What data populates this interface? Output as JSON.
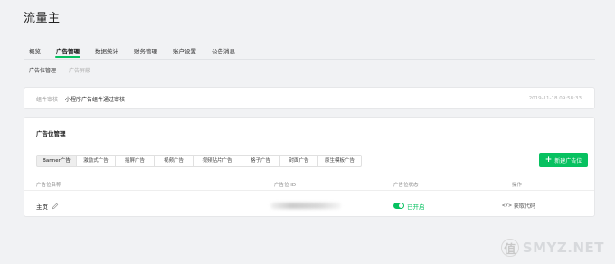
{
  "header": {
    "title": "流量主"
  },
  "main_tabs": [
    {
      "label": "概览"
    },
    {
      "label": "广告管理",
      "active": true
    },
    {
      "label": "数据统计"
    },
    {
      "label": "财务管理"
    },
    {
      "label": "账户设置"
    },
    {
      "label": "公告消息"
    }
  ],
  "sub_tabs": [
    {
      "label": "广告位管理",
      "active": true
    },
    {
      "label": "广告屏蔽",
      "disabled": true
    }
  ],
  "notice": {
    "label": "组件审核",
    "text": "小程序广告组件通过审核",
    "time": "2019-11-18 09:58:33"
  },
  "ad_slots": {
    "title": "广告位管理",
    "type_tabs": [
      "Banner广告",
      "激励式广告",
      "插屏广告",
      "视频广告",
      "视频贴片广告",
      "格子广告",
      "封面广告",
      "原生模板广告"
    ],
    "new_button": {
      "icon": "plus-icon",
      "label": "新建广告位"
    },
    "columns": [
      "广告位名称",
      "广告位 ID",
      "广告位状态",
      "操作"
    ],
    "rows": [
      {
        "name": "主页",
        "status": "已开启",
        "enabled": true,
        "action": "获取代码"
      }
    ]
  },
  "watermark": {
    "badge": "值",
    "text": "SMYZ.NET"
  },
  "colors": {
    "accent": "#07c160",
    "background": "#f1f2f4",
    "card": "#ffffff"
  }
}
